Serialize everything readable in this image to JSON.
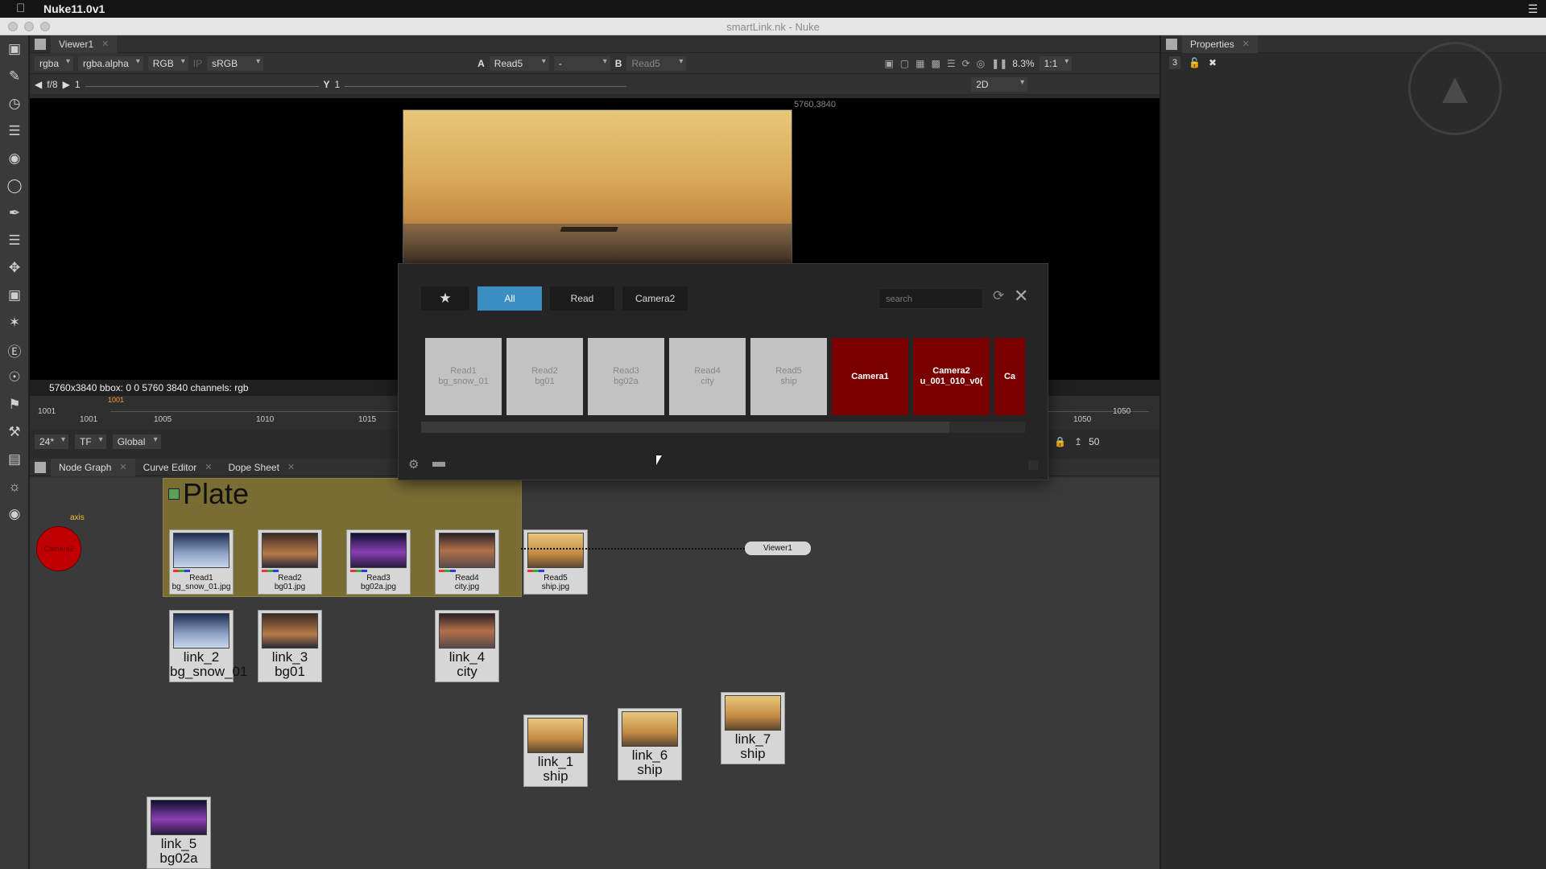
{
  "mac_menu": {
    "app_name": "Nuke11.0v1"
  },
  "window": {
    "title": "smartLink.nk - Nuke"
  },
  "viewer": {
    "tab_label": "Viewer1",
    "channels": "rgba",
    "alpha_channel": "rgba.alpha",
    "display_channels": "RGB",
    "ip": "IP",
    "lut": "sRGB",
    "input_a_label": "A",
    "input_a": "Read5",
    "wipe": "-",
    "input_b_label": "B",
    "input_b": "Read5",
    "zoom": "8.3%",
    "ratio": "1:1",
    "fstop": "f/8",
    "gain": "1",
    "y_label": "Y",
    "gamma": "1",
    "mode": "2D",
    "resolution": "5760,3840",
    "info": "5760x3840  bbox: 0 0 5760 3840 channels: rgb"
  },
  "timeline": {
    "start": "1001",
    "playhead": "1001",
    "ticks": [
      "1001",
      "1005",
      "1010",
      "1015",
      "1050"
    ],
    "end": "1050",
    "fps": "24*",
    "tf": "TF",
    "range_mode": "Global",
    "frame_increment": "50"
  },
  "properties": {
    "tab_label": "Properties",
    "max_panels": "3"
  },
  "node_graph": {
    "tabs": [
      {
        "label": "Node Graph"
      },
      {
        "label": "Curve Editor"
      },
      {
        "label": "Dope Sheet"
      }
    ],
    "backdrop_title": "Plate",
    "camera_label": "Camera2",
    "axis_label": "axis",
    "viewer_node": "Viewer1",
    "read_nodes": [
      {
        "label": "Read1\nbg_snow_01.jpg",
        "thumb": "snow"
      },
      {
        "label": "Read2\nbg01.jpg",
        "thumb": "bg01"
      },
      {
        "label": "Read3\nbg02a.jpg",
        "thumb": "bg02a"
      },
      {
        "label": "Read4\ncity.jpg",
        "thumb": "city"
      },
      {
        "label": "Read5\nship.jpg",
        "thumb": "ship"
      }
    ],
    "link_nodes": [
      {
        "label": "link_2\nbg_snow_01",
        "thumb": "snow"
      },
      {
        "label": "link_3\nbg01",
        "thumb": "bg01"
      },
      {
        "label": "link_4\ncity",
        "thumb": "city"
      },
      {
        "label": "link_1\nship",
        "thumb": "ship"
      },
      {
        "label": "link_6\nship",
        "thumb": "ship"
      },
      {
        "label": "link_7\nship",
        "thumb": "ship"
      },
      {
        "label": "link_5\nbg02a",
        "thumb": "bg02a"
      }
    ]
  },
  "smartlink_dialog": {
    "tabs": [
      {
        "label": "★",
        "active": false
      },
      {
        "label": "All",
        "active": true
      },
      {
        "label": "Read",
        "active": false
      },
      {
        "label": "Camera2",
        "active": false
      }
    ],
    "search_placeholder": "search",
    "cards": [
      {
        "label": "Read1\nbg_snow_01",
        "kind": "read"
      },
      {
        "label": "Read2\nbg01",
        "kind": "read"
      },
      {
        "label": "Read3\nbg02a",
        "kind": "read"
      },
      {
        "label": "Read4\ncity",
        "kind": "read"
      },
      {
        "label": "Read5\nship",
        "kind": "read"
      },
      {
        "label": "Camera1",
        "kind": "camera"
      },
      {
        "label": "Camera2\nu_001_010_v0(",
        "kind": "camera"
      },
      {
        "label": "Ca",
        "kind": "camera"
      }
    ]
  },
  "colors": {
    "active_tab": "#3b8ec2",
    "camera_card": "#7a0000",
    "backdrop": "#7a6d34"
  }
}
